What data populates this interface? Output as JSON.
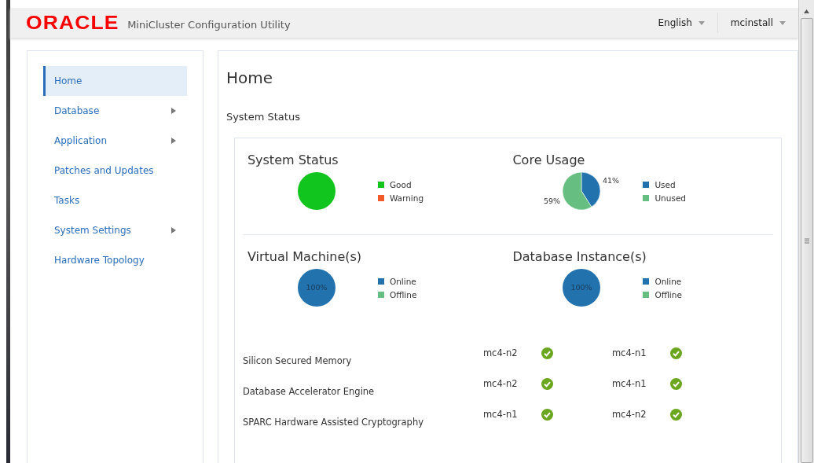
{
  "header": {
    "logo": "ORACLE",
    "title": "MiniCluster Configuration Utility",
    "menus": [
      {
        "label": "English"
      },
      {
        "label": "mcinstall"
      }
    ]
  },
  "sidebar": {
    "items": [
      {
        "label": "Home",
        "selected": true,
        "submenu": false
      },
      {
        "label": "Database",
        "selected": false,
        "submenu": true
      },
      {
        "label": "Application",
        "selected": false,
        "submenu": true
      },
      {
        "label": "Patches and Updates",
        "selected": false,
        "submenu": false
      },
      {
        "label": "Tasks",
        "selected": false,
        "submenu": false
      },
      {
        "label": "System Settings",
        "selected": false,
        "submenu": true
      },
      {
        "label": "Hardware Topology",
        "selected": false,
        "submenu": false
      }
    ]
  },
  "page": {
    "title": "Home",
    "section": "System Status",
    "charts": [
      {
        "title": "System Status",
        "chart_data": {
          "type": "pie",
          "categories": [
            "Good",
            "Warning"
          ],
          "colors": [
            "#11c51e",
            "#f15a29"
          ],
          "values": [
            100,
            0
          ]
        }
      },
      {
        "title": "Core Usage",
        "chart_data": {
          "type": "pie",
          "categories": [
            "Used",
            "Unused"
          ],
          "colors": [
            "#2272ae",
            "#66bf80"
          ],
          "values": [
            41,
            59
          ],
          "value_labels": [
            "41%",
            "59%"
          ]
        }
      },
      {
        "title": "Virtual Machine(s)",
        "chart_data": {
          "type": "pie",
          "categories": [
            "Online",
            "Offline"
          ],
          "colors": [
            "#2272ae",
            "#66bf80"
          ],
          "values": [
            100,
            0
          ],
          "value_labels": [
            "100%",
            null
          ]
        }
      },
      {
        "title": "Database Instance(s)",
        "chart_data": {
          "type": "pie",
          "categories": [
            "Online",
            "Offline"
          ],
          "colors": [
            "#2272ae",
            "#66bf80"
          ],
          "values": [
            100,
            0
          ],
          "value_labels": [
            "100%",
            null
          ]
        }
      }
    ],
    "features": [
      {
        "name": "Silicon Secured Memory",
        "nodes": [
          {
            "name": "mc4-n2",
            "ok": true
          },
          {
            "name": "mc4-n1",
            "ok": true
          }
        ]
      },
      {
        "name": "Database Accelerator Engine",
        "nodes": [
          {
            "name": "mc4-n2",
            "ok": true
          },
          {
            "name": "mc4-n1",
            "ok": true
          }
        ]
      },
      {
        "name": "SPARC Hardware Assisted Cryptography",
        "nodes": [
          {
            "name": "mc4-n1",
            "ok": true
          },
          {
            "name": "mc4-n2",
            "ok": true
          }
        ]
      }
    ]
  }
}
